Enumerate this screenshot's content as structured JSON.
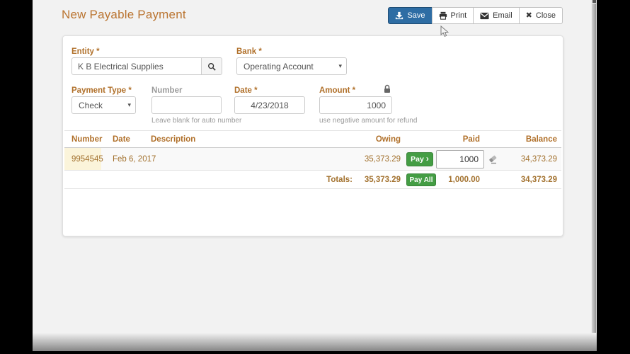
{
  "page": {
    "title": "New Payable Payment"
  },
  "toolbar": {
    "save_label": "Save",
    "print_label": "Print",
    "email_label": "Email",
    "close_label": "Close"
  },
  "form": {
    "entity": {
      "label": "Entity *",
      "value": "K B Electrical Supplies"
    },
    "bank": {
      "label": "Bank *",
      "value": "Operating Account"
    },
    "payment_type": {
      "label": "Payment Type *",
      "value": "Check"
    },
    "number": {
      "label": "Number",
      "value": "",
      "helper": "Leave blank for auto number"
    },
    "date": {
      "label": "Date *",
      "value": "4/23/2018"
    },
    "amount": {
      "label": "Amount *",
      "value": "1000",
      "helper": "use negative amount for refund"
    }
  },
  "table": {
    "headers": [
      "Number",
      "Date",
      "Description",
      "Owing",
      "Paid",
      "Balance"
    ],
    "rows": [
      {
        "number": "9954545",
        "date": "Feb 6, 2017",
        "description": "",
        "owing": "35,373.29",
        "pay_label": "Pay",
        "paid_input": "1000",
        "balance": "34,373.29"
      }
    ],
    "totals": {
      "label": "Totals:",
      "owing": "35,373.29",
      "pay_all_label": "Pay All",
      "paid": "1,000.00",
      "balance": "34,373.29"
    }
  },
  "icons": {
    "caret_down": "▾",
    "close_x": "✖",
    "chevron_right": "›"
  },
  "colors": {
    "accent_text": "#b0702a",
    "title_text": "#ba7430",
    "primary_button": "#2e6da4",
    "success_button": "#449d44",
    "row_highlight": "#fbf4da",
    "page_background": "#f2f2f2"
  }
}
